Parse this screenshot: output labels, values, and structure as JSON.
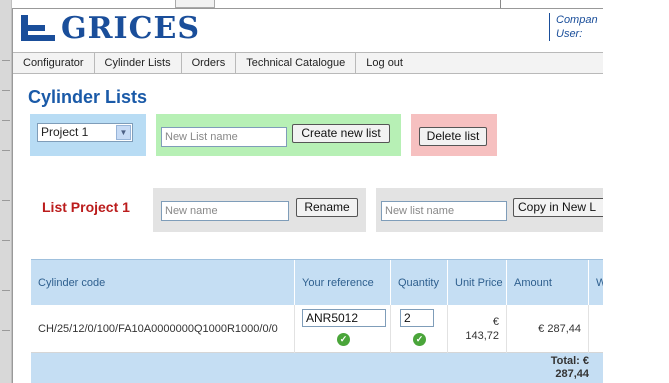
{
  "header": {
    "logo_text": "GRICES",
    "company_label": "Compan",
    "user_label": "User:"
  },
  "nav": {
    "items": [
      "Configurator",
      "Cylinder Lists",
      "Orders",
      "Technical Catalogue",
      "Log out"
    ]
  },
  "page_title": "Cylinder Lists",
  "project_select": {
    "value": "Project 1"
  },
  "new_list": {
    "placeholder": "New List name",
    "button": "Create new list"
  },
  "delete_list": {
    "button": "Delete list"
  },
  "list": {
    "title": "List Project 1",
    "rename_placeholder": "New name",
    "rename_button": "Rename",
    "copy_placeholder": "New list name",
    "copy_button": "Copy in New L"
  },
  "table": {
    "headers": [
      "Cylinder code",
      "Your reference",
      "Quantity",
      "Unit Price",
      "Amount",
      "W"
    ],
    "rows": [
      {
        "code": "CH/25/12/0/100/FA10A0000000Q1000R1000/0/0",
        "reference": "ANR5012",
        "quantity": "2",
        "unit_price_currency": "€",
        "unit_price": "143,72",
        "amount": "€ 287,44"
      }
    ],
    "total_label": "Total: €",
    "total_value": "287,44",
    "total_cut": "T"
  },
  "colors": {
    "brand_blue": "#1a4e9a",
    "title_blue": "#1a5aa8",
    "list_red": "#bb1c1c",
    "box_blue": "#b8dcf4",
    "box_green": "#b7f0b5",
    "box_red": "#f6c0c0",
    "table_header": "#c5def3"
  }
}
